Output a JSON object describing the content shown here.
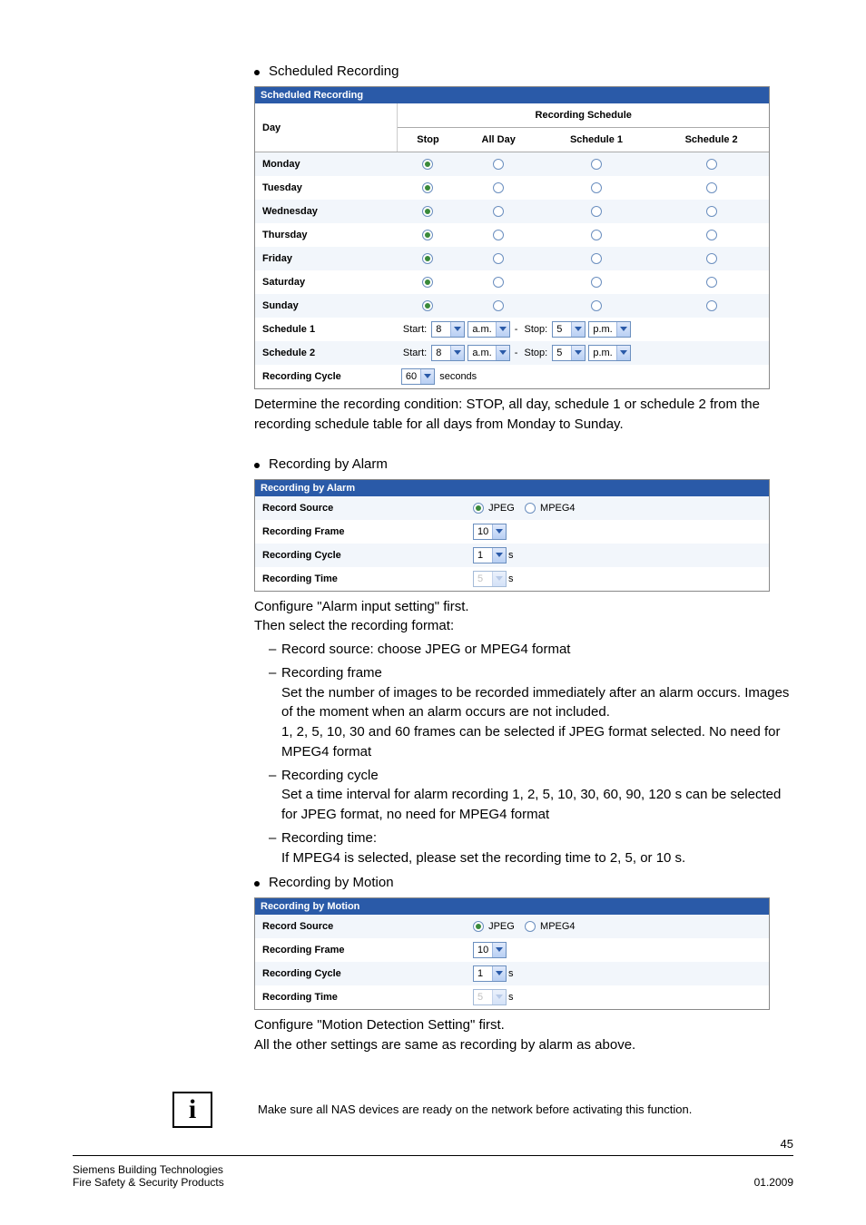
{
  "sections": {
    "scheduled": {
      "title": "Scheduled Recording",
      "panelTitle": "Scheduled Recording",
      "dayHeader": "Day",
      "recSchedHeader": "Recording Schedule",
      "cols": [
        "Stop",
        "All Day",
        "Schedule 1",
        "Schedule 2"
      ],
      "days": [
        "Monday",
        "Tuesday",
        "Wednesday",
        "Thursday",
        "Friday",
        "Saturday",
        "Sunday"
      ],
      "schedule1Label": "Schedule 1",
      "schedule2Label": "Schedule 2",
      "recordingCycleLabel": "Recording Cycle",
      "startLabel": "Start:",
      "stopLabel": "Stop:",
      "dash": "-",
      "sched1": {
        "startHour": "8",
        "startAmPm": "a.m.",
        "stopHour": "5",
        "stopAmPm": "p.m."
      },
      "sched2": {
        "startHour": "8",
        "startAmPm": "a.m.",
        "stopHour": "5",
        "stopAmPm": "p.m."
      },
      "cycleValue": "60",
      "cycleUnit": "seconds",
      "para1": "Determine the recording condition: STOP, all day, schedule 1 or schedule 2 from the recording schedule table for all days from Monday to Sunday."
    },
    "alarm": {
      "title": "Recording by Alarm",
      "panelTitle": "Recording by Alarm",
      "rows": {
        "recordSource": "Record Source",
        "recordingFrame": "Recording Frame",
        "recordingCycle": "Recording Cycle",
        "recordingTime": "Recording Time"
      },
      "jpeg": "JPEG",
      "mpeg4": "MPEG4",
      "frameVal": "10",
      "cycleVal": "1",
      "timeVal": "5",
      "sUnit": "s",
      "para1": "Configure \"Alarm input setting\" first.",
      "para2": "Then select the recording format:",
      "list": {
        "a": "Record source: choose JPEG or MPEG4 format",
        "b_title": "Recording frame",
        "b_line1": "Set the number of images to be recorded immediately after an alarm occurs. Images of the moment when an alarm occurs are not included.",
        "b_line2": "1, 2, 5, 10, 30 and 60 frames can be selected if JPEG format selected. No need for MPEG4 format",
        "c_title": "Recording cycle",
        "c_line1": "Set a time interval for alarm recording 1, 2, 5, 10, 30, 60, 90, 120 s can be selected for JPEG format, no need for MPEG4 format",
        "d_title": "Recording time:",
        "d_line1": "If MPEG4 is selected, please set the recording time to 2, 5, or 10 s."
      }
    },
    "motion": {
      "title": "Recording by Motion",
      "panelTitle": "Recording by Motion",
      "rows": {
        "recordSource": "Record Source",
        "recordingFrame": "Recording Frame",
        "recordingCycle": "Recording Cycle",
        "recordingTime": "Recording Time"
      },
      "jpeg": "JPEG",
      "mpeg4": "MPEG4",
      "frameVal": "10",
      "cycleVal": "1",
      "timeVal": "5",
      "sUnit": "s",
      "para1": "Configure \"Motion Detection Setting\" first.",
      "para2": "All the other settings are same as recording by alarm as above."
    }
  },
  "note": "Make sure all NAS devices are ready on the network before activating this function.",
  "footer": {
    "page": "45",
    "left1": "Siemens Building Technologies",
    "left2": "Fire Safety & Security Products",
    "right": "01.2009"
  }
}
